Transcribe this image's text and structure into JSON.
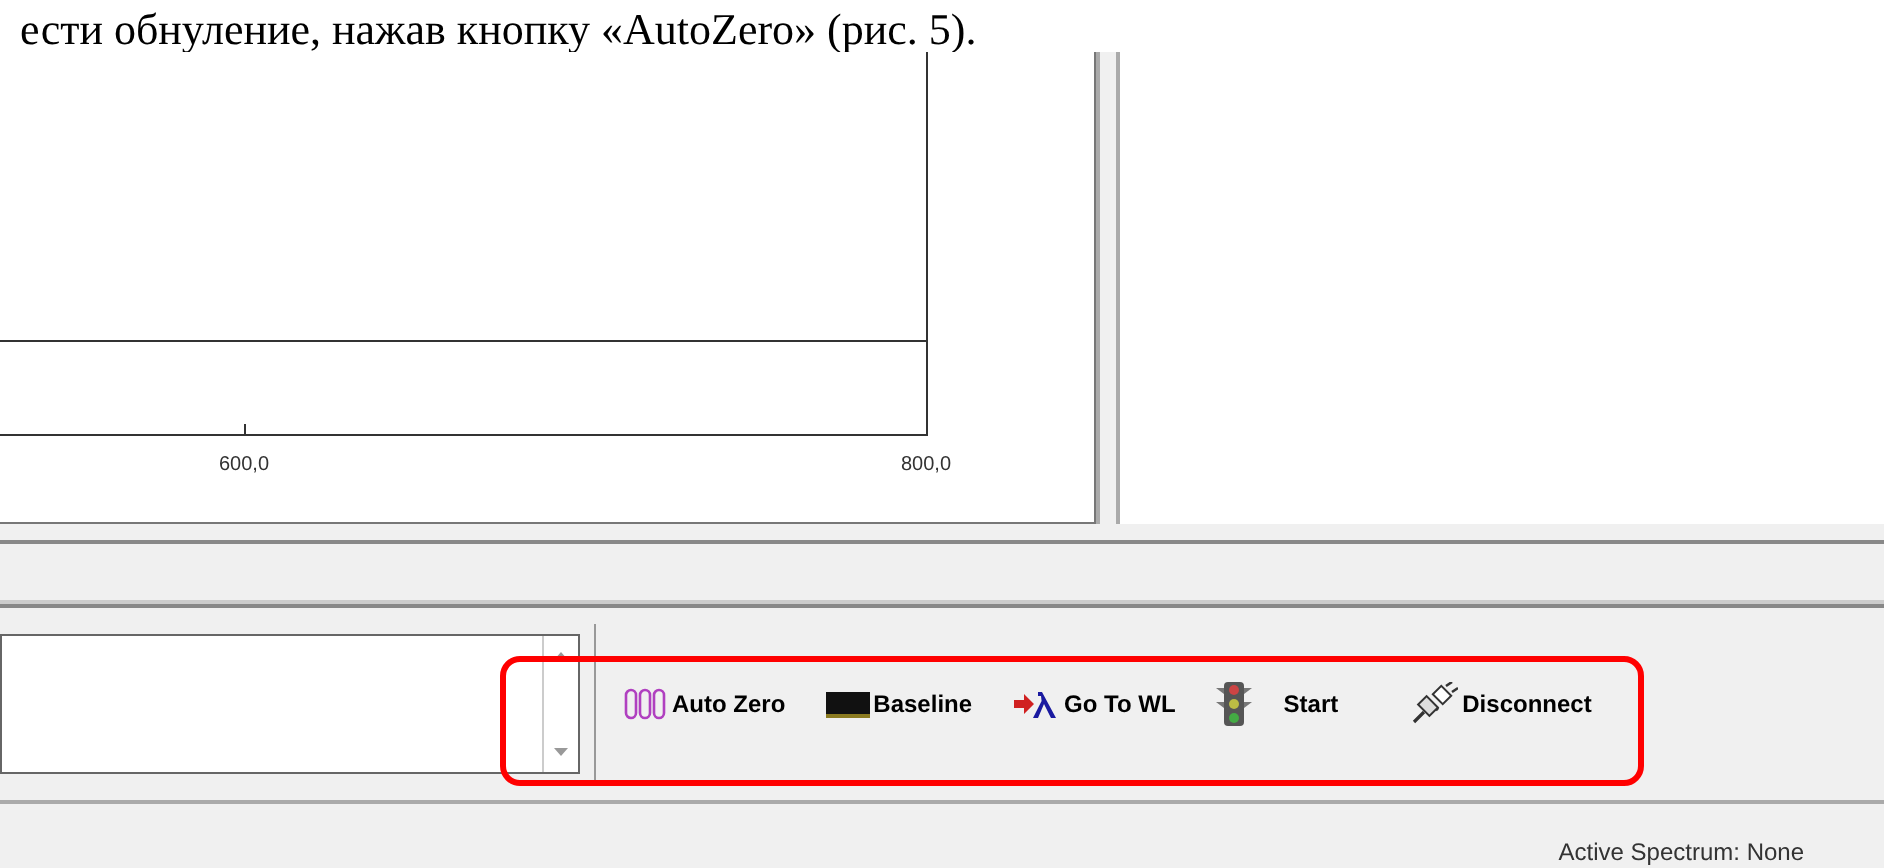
{
  "caption": "ести обнуление, нажав кнопку «AutoZero» (рис. 5).",
  "chart": {
    "x_tick_labels": [
      "600,0",
      "800,0"
    ]
  },
  "toolbar": [
    {
      "kind": "autozero",
      "label": "Auto Zero"
    },
    {
      "kind": "baseline",
      "label": "Baseline"
    },
    {
      "kind": "gotowl",
      "label": "Go To WL"
    },
    {
      "kind": "start",
      "label": "Start"
    },
    {
      "kind": "disconnect",
      "label": "Disconnect"
    }
  ],
  "status_bar": {
    "text": "Active Spectrum: None"
  }
}
